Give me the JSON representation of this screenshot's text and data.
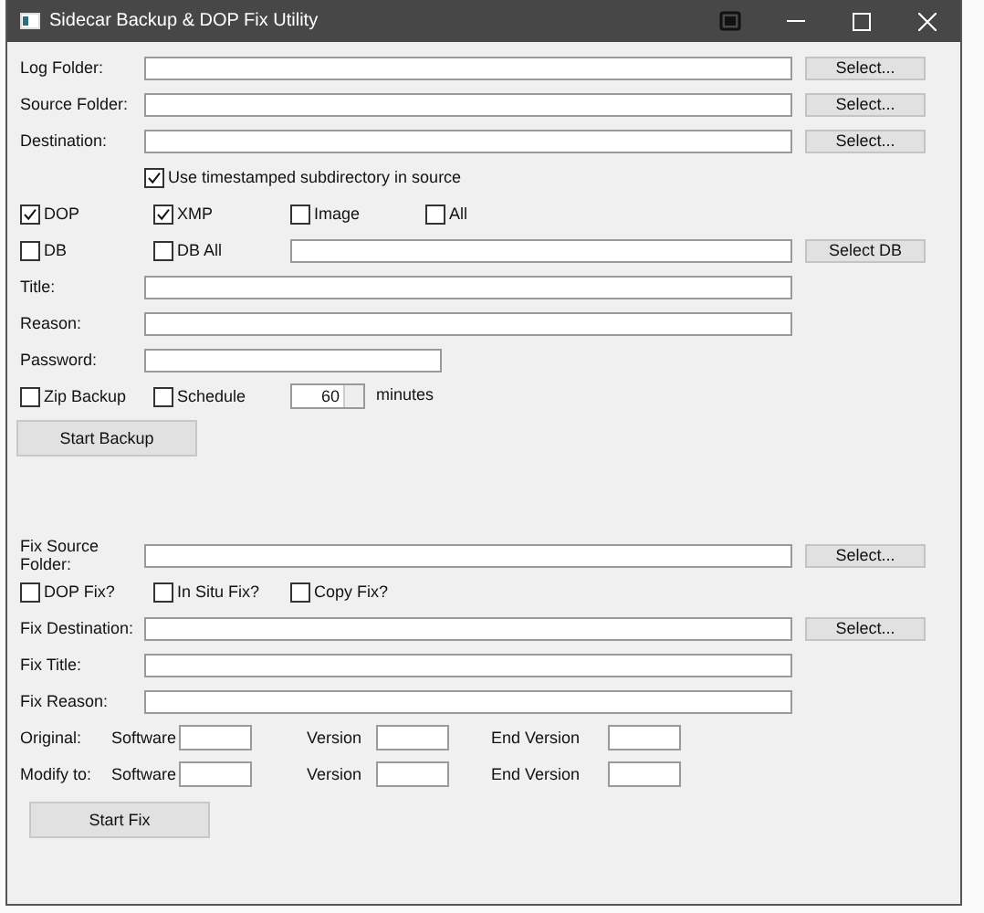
{
  "window": {
    "title": "Sidecar Backup & DOP Fix Utility"
  },
  "folders": [
    {
      "label": "Log Folder:",
      "button": "Select..."
    },
    {
      "label": "Source Folder:",
      "button": "Select..."
    },
    {
      "label": "Destination:",
      "button": "Select..."
    }
  ],
  "timestamp_option": {
    "label": "Use timestamped subdirectory in source",
    "checked": true
  },
  "types": [
    {
      "label": "DOP",
      "checked": true
    },
    {
      "label": "XMP",
      "checked": true
    },
    {
      "label": "Image",
      "checked": false
    },
    {
      "label": "All",
      "checked": false
    }
  ],
  "db": {
    "options": [
      {
        "label": "DB",
        "checked": false
      },
      {
        "label": "DB All",
        "checked": false
      }
    ],
    "button": "Select DB"
  },
  "fields": [
    {
      "label": "Title:",
      "kind": "wide"
    },
    {
      "label": "Reason:",
      "kind": "wide"
    },
    {
      "label": "Password:",
      "kind": "short"
    }
  ],
  "schedule": {
    "options": [
      {
        "label": "Zip Backup",
        "checked": false
      },
      {
        "label": "Schedule",
        "checked": false
      }
    ],
    "value": "60",
    "unit": "minutes"
  },
  "start_backup": {
    "label": "Start Backup"
  },
  "fix_source": {
    "label": "Fix Source Folder:",
    "button": "Select..."
  },
  "fix_options": [
    {
      "label": "DOP Fix?",
      "checked": false
    },
    {
      "label": "In Situ Fix?",
      "checked": false
    },
    {
      "label": "Copy Fix?",
      "checked": false
    }
  ],
  "fix_destination": {
    "label": "Fix Destination:",
    "button": "Select..."
  },
  "fix_fields": [
    {
      "label": "Fix Title:"
    },
    {
      "label": "Fix Reason:"
    }
  ],
  "versions": [
    {
      "label": "Original:",
      "software": "Software",
      "version": "Version",
      "end_version": "End Version"
    },
    {
      "label": "Modify to:",
      "software": "Software",
      "version": "Version",
      "end_version": "End Version"
    }
  ],
  "start_fix": {
    "label": "Start Fix"
  }
}
